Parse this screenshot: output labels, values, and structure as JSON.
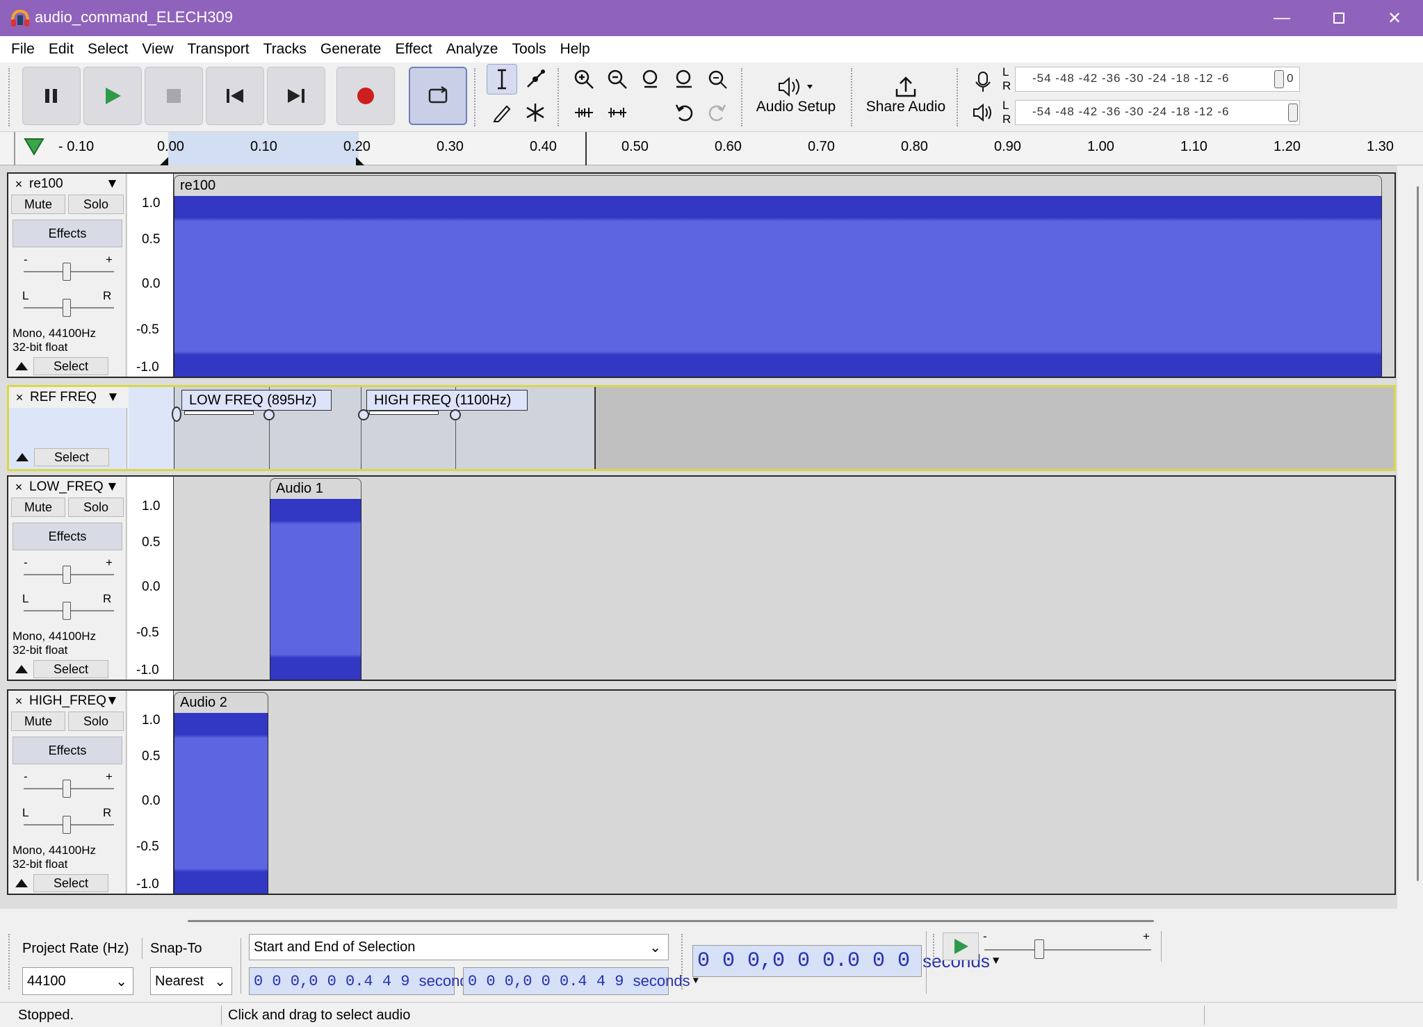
{
  "window": {
    "title": "audio_command_ELECH309"
  },
  "menu": [
    "File",
    "Edit",
    "Select",
    "View",
    "Transport",
    "Tracks",
    "Generate",
    "Effect",
    "Analyze",
    "Tools",
    "Help"
  ],
  "toolbar": {
    "audio_setup": "Audio Setup",
    "share_audio": "Share Audio",
    "meter_ticks": "-54  -48  -42  -36  -30  -24  -18  -12   -6",
    "meter_lr_l": "L",
    "meter_lr_r": "R",
    "rec_meter_end": "0"
  },
  "ruler": {
    "ticks": [
      "- 0.10",
      "0.00",
      "0.10",
      "0.20",
      "0.30",
      "0.40",
      "0.50",
      "0.60",
      "0.70",
      "0.80",
      "0.90",
      "1.00",
      "1.10",
      "1.20",
      "1.30"
    ]
  },
  "track_common": {
    "mute": "Mute",
    "solo": "Solo",
    "effects": "Effects",
    "select": "Select",
    "format_line1": "Mono, 44100Hz",
    "format_line2": "32-bit float",
    "gain_minus": "-",
    "gain_plus": "+",
    "pan_l": "L",
    "pan_r": "R",
    "close": "×"
  },
  "scale": [
    "1.0",
    "0.5",
    "0.0",
    "-0.5",
    "-1.0"
  ],
  "tracks": [
    {
      "name": "re100",
      "clip": "re100"
    },
    {
      "name": "REF FREQ",
      "label1": "LOW FREQ (895Hz)",
      "label2": "HIGH FREQ (1100Hz)"
    },
    {
      "name": "LOW_FREQ",
      "clip": "Audio 1"
    },
    {
      "name": "HIGH_FREQ",
      "clip": "Audio 2"
    }
  ],
  "bottom": {
    "project_rate_label": "Project Rate (Hz)",
    "snap_label": "Snap-To",
    "rate_value": "44100",
    "snap_value": "Nearest",
    "selection_mode": "Start and End of Selection",
    "sel_start": "0 0 0,0 0 0.4 4 9",
    "sel_end": "0 0 0,0 0 0.4 4 9",
    "units": "seconds",
    "time_display": "0 0 0,0 0 0.0 0 0",
    "play_speed_minus": "-",
    "play_speed_plus": "+"
  },
  "status": {
    "state": "Stopped.",
    "hint": "Click and drag to select audio"
  },
  "colors": {
    "titlebar": "#8f63bb",
    "waveform": "#5d66e0",
    "waveform_dark": "#3238c4",
    "selection": "#d2def1"
  }
}
